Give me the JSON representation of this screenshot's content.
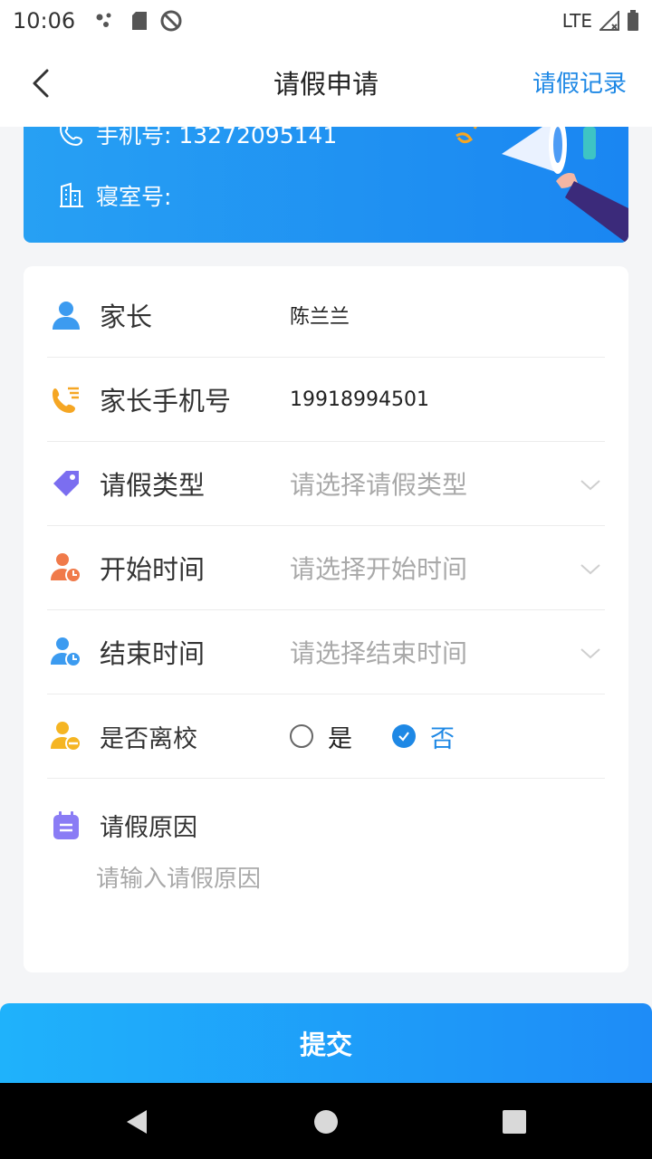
{
  "status_bar": {
    "time": "10:06",
    "network": "LTE"
  },
  "header": {
    "title": "请假申请",
    "record_link": "请假记录"
  },
  "banner": {
    "phone_label": "手机号: 13272095141",
    "dorm_label": "寝室号:"
  },
  "form": {
    "parent_label": "家长",
    "parent_value": "陈兰兰",
    "parent_phone_label": "家长手机号",
    "parent_phone_value": "19918994501",
    "leave_type_label": "请假类型",
    "leave_type_placeholder": "请选择请假类型",
    "start_time_label": "开始时间",
    "start_time_placeholder": "请选择开始时间",
    "end_time_label": "结束时间",
    "end_time_placeholder": "请选择结束时间",
    "leave_school_label": "是否离校",
    "leave_school_options": [
      "是",
      "否"
    ],
    "leave_school_selected": "否",
    "reason_label": "请假原因",
    "reason_placeholder": "请输入请假原因"
  },
  "submit_label": "提交",
  "colors": {
    "accent": "#1e88e5",
    "banner": "#1a86f2"
  },
  "icons": {
    "parent": "user-icon",
    "parent_phone": "phone-list-icon",
    "leave_type": "tag-icon",
    "start_time": "user-clock-icon",
    "end_time": "user-clock-icon",
    "leave_school": "user-minus-icon",
    "reason": "note-icon"
  }
}
